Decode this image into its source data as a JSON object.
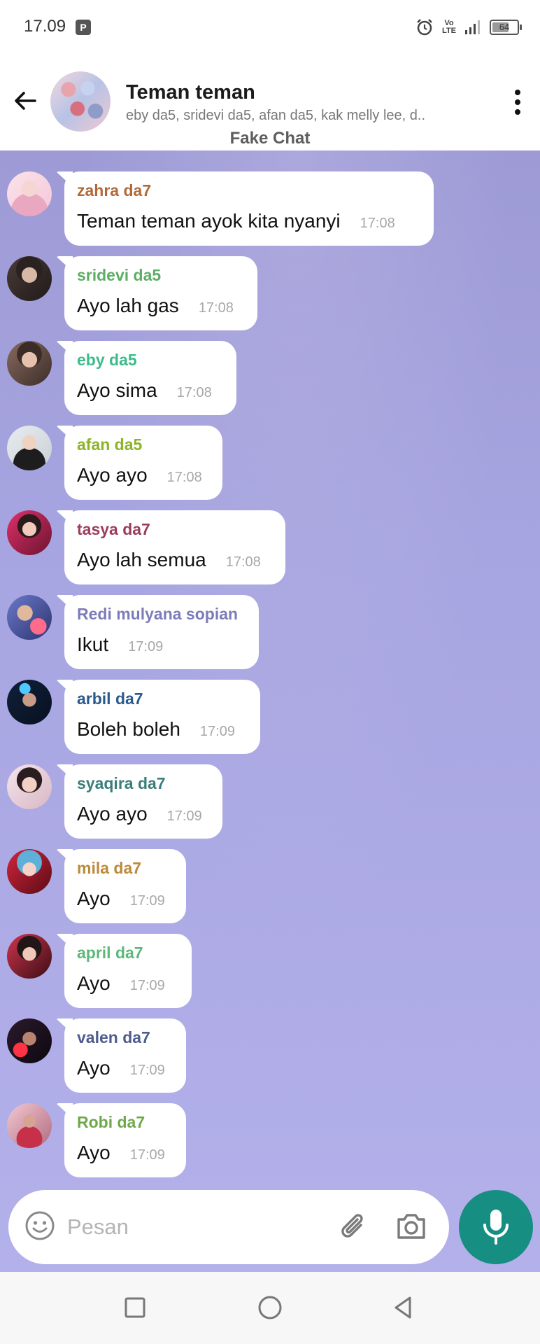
{
  "status_bar": {
    "time": "17.09",
    "volte_line1": "Vo",
    "volte_line2": "LTE",
    "battery": "64"
  },
  "header": {
    "title": "Teman teman",
    "members": "eby da5, sridevi da5, afan da5, kak melly lee, d..",
    "watermark": "Fake Chat"
  },
  "messages": [
    {
      "sender": "zahra da7",
      "text": "Teman teman ayok kita nyanyi",
      "time": "17:08",
      "color": "#b06a3a"
    },
    {
      "sender": "sridevi da5",
      "text": "Ayo lah gas",
      "time": "17:08",
      "color": "#5cae64"
    },
    {
      "sender": "eby da5",
      "text": "Ayo sima",
      "time": "17:08",
      "color": "#3dbb8a"
    },
    {
      "sender": "afan da5",
      "text": "Ayo ayo",
      "time": "17:08",
      "color": "#8db328"
    },
    {
      "sender": "tasya da7",
      "text": "Ayo lah semua",
      "time": "17:08",
      "color": "#9b3c5c"
    },
    {
      "sender": "Redi mulyana sopian",
      "text": "Ikut",
      "time": "17:09",
      "color": "#7d7cb9"
    },
    {
      "sender": "arbil da7",
      "text": "Boleh boleh",
      "time": "17:09",
      "color": "#2a5a8c"
    },
    {
      "sender": "syaqira da7",
      "text": "Ayo ayo",
      "time": "17:09",
      "color": "#3b7e79"
    },
    {
      "sender": "mila da7",
      "text": "Ayo",
      "time": "17:09",
      "color": "#bb8a3a"
    },
    {
      "sender": "april da7",
      "text": "Ayo",
      "time": "17:09",
      "color": "#5cb97a"
    },
    {
      "sender": "valen da7",
      "text": "Ayo",
      "time": "17:09",
      "color": "#4d5d8f"
    },
    {
      "sender": "Robi da7",
      "text": "Ayo",
      "time": "17:09",
      "color": "#6fa84a"
    }
  ],
  "composer": {
    "placeholder": "Pesan"
  },
  "icons": {
    "back": "arrow-left-icon",
    "more": "more-vertical-icon",
    "emoji": "emoji-icon",
    "attach": "paperclip-icon",
    "camera": "camera-icon",
    "mic": "microphone-icon",
    "nav_recent": "square-icon",
    "nav_home": "circle-icon",
    "nav_back": "triangle-back-icon"
  },
  "colors": {
    "accent": "#168e81",
    "chat_background": "#a7a5e1"
  }
}
